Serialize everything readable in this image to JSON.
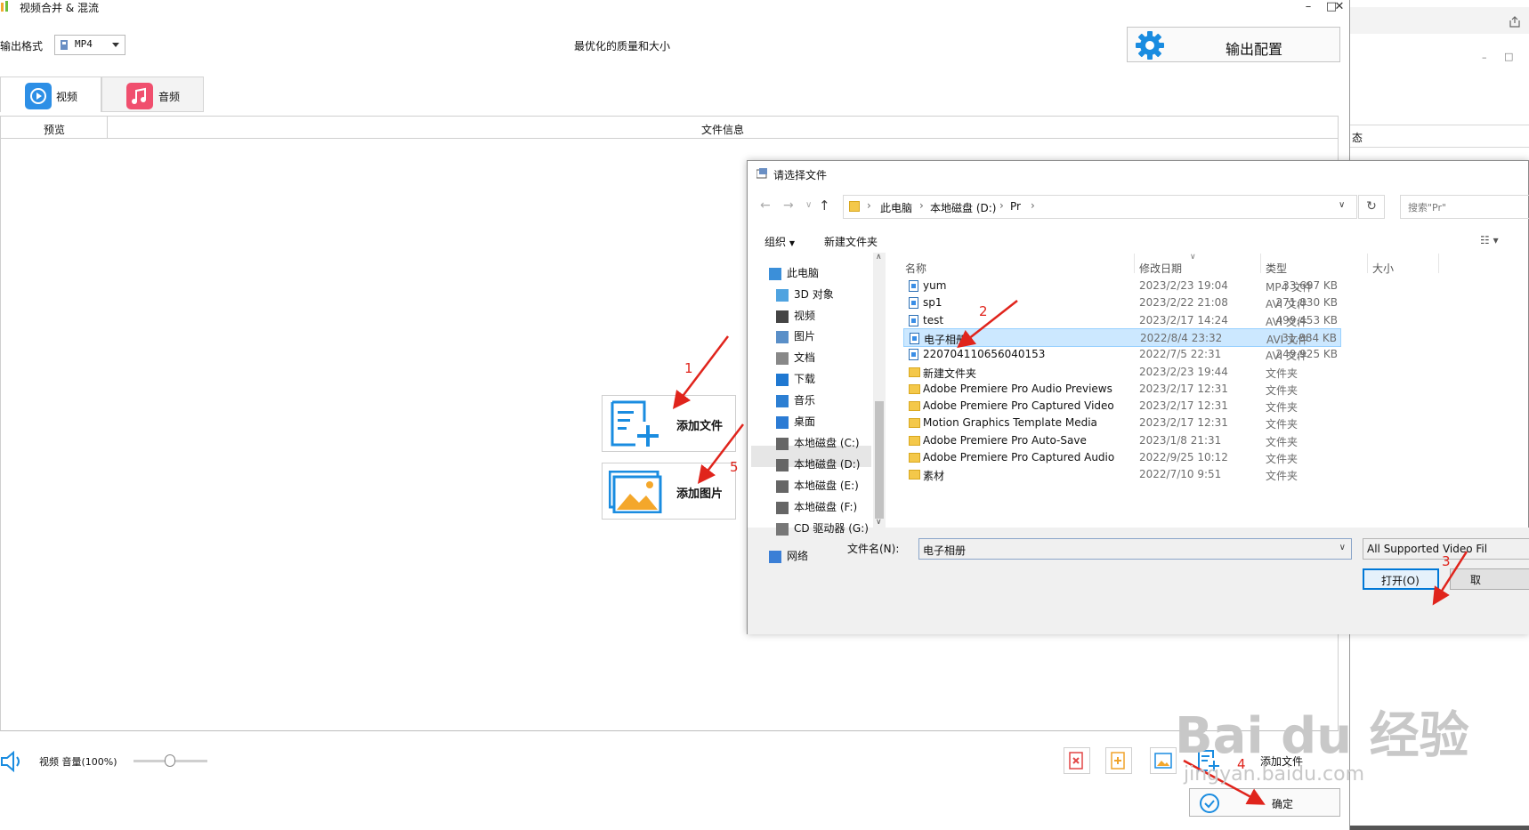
{
  "main": {
    "title": "视频合并 & 混流",
    "output_format_label": "输出格式",
    "output_format_value": "MP4",
    "quality_text": "最优化的质量和大小",
    "output_config_label": "输出配置",
    "tabs": [
      {
        "label": "视频",
        "active": true
      },
      {
        "label": "音频",
        "active": false
      }
    ],
    "table": {
      "columns": [
        "预览",
        "文件信息"
      ]
    },
    "add_file_label": "添加文件",
    "add_image_label": "添加图片",
    "bottom": {
      "volume_label": "视频 音量(100%)",
      "volume_value": 0.5,
      "add_file_label": "添加文件",
      "ok_label": "确定"
    }
  },
  "right_window": {
    "partial_text": "态"
  },
  "dialog": {
    "title": "请选择文件",
    "breadcrumb": [
      "此电脑",
      "本地磁盘 (D:)",
      "Pr"
    ],
    "search_placeholder": "搜索\"Pr\"",
    "toolbar": {
      "organize": "组织",
      "new_folder": "新建文件夹"
    },
    "nav": [
      {
        "label": "此电脑",
        "icon": "computer-icon"
      },
      {
        "label": "3D 对象",
        "icon": "cube-icon"
      },
      {
        "label": "视频",
        "icon": "film-icon"
      },
      {
        "label": "图片",
        "icon": "picture-icon"
      },
      {
        "label": "文档",
        "icon": "document-icon"
      },
      {
        "label": "下载",
        "icon": "download-icon"
      },
      {
        "label": "音乐",
        "icon": "music-icon"
      },
      {
        "label": "桌面",
        "icon": "desktop-icon"
      },
      {
        "label": "本地磁盘 (C:)",
        "icon": "drive-icon"
      },
      {
        "label": "本地磁盘 (D:)",
        "icon": "drive-icon",
        "selected": true
      },
      {
        "label": "本地磁盘 (E:)",
        "icon": "drive-icon"
      },
      {
        "label": "本地磁盘 (F:)",
        "icon": "drive-icon"
      },
      {
        "label": "CD 驱动器 (G:)",
        "icon": "cd-icon"
      },
      {
        "label": "网络",
        "icon": "network-icon"
      }
    ],
    "columns": [
      "名称",
      "修改日期",
      "类型",
      "大小"
    ],
    "files": [
      {
        "name": "yum",
        "date": "2023/2/23 19:04",
        "type": "MP4 文件",
        "size": "33,697 KB",
        "kind": "video"
      },
      {
        "name": "sp1",
        "date": "2023/2/22 21:08",
        "type": "AVI 文件",
        "size": "271,830 KB",
        "kind": "video"
      },
      {
        "name": "test",
        "date": "2023/2/17 14:24",
        "type": "AVI 文件",
        "size": "499,453 KB",
        "kind": "video"
      },
      {
        "name": "电子相册",
        "date": "2022/8/4 23:32",
        "type": "AVI 文件",
        "size": "31,884 KB",
        "kind": "video",
        "selected": true
      },
      {
        "name": "220704110656040153",
        "date": "2022/7/5 22:31",
        "type": "AVI 文件",
        "size": "249,925 KB",
        "kind": "video"
      },
      {
        "name": "新建文件夹",
        "date": "2023/2/23 19:44",
        "type": "文件夹",
        "size": "",
        "kind": "folder"
      },
      {
        "name": "Adobe Premiere Pro Audio Previews",
        "date": "2023/2/17 12:31",
        "type": "文件夹",
        "size": "",
        "kind": "folder"
      },
      {
        "name": "Adobe Premiere Pro Captured Video",
        "date": "2023/2/17 12:31",
        "type": "文件夹",
        "size": "",
        "kind": "folder"
      },
      {
        "name": "Motion Graphics Template Media",
        "date": "2023/2/17 12:31",
        "type": "文件夹",
        "size": "",
        "kind": "folder"
      },
      {
        "name": "Adobe Premiere Pro Auto-Save",
        "date": "2023/1/8 21:31",
        "type": "文件夹",
        "size": "",
        "kind": "folder"
      },
      {
        "name": "Adobe Premiere Pro Captured Audio",
        "date": "2022/9/25 10:12",
        "type": "文件夹",
        "size": "",
        "kind": "folder"
      },
      {
        "name": "素材",
        "date": "2022/7/10 9:51",
        "type": "文件夹",
        "size": "",
        "kind": "folder"
      }
    ],
    "filename_label": "文件名(N):",
    "filename_value": "电子相册",
    "filetype_value": "All Supported Video Fil",
    "open_label": "打开(O)",
    "cancel_label": "取"
  },
  "annotations": [
    "1",
    "2",
    "3",
    "4",
    "5"
  ],
  "watermark": {
    "logo": "Bai du 经验",
    "url": "jingyan.baidu.com"
  },
  "colors": {
    "accent": "#1a8ce0",
    "selection": "#cce8ff",
    "annotation": "#e0241c",
    "music_tab": "#f04f6e"
  }
}
